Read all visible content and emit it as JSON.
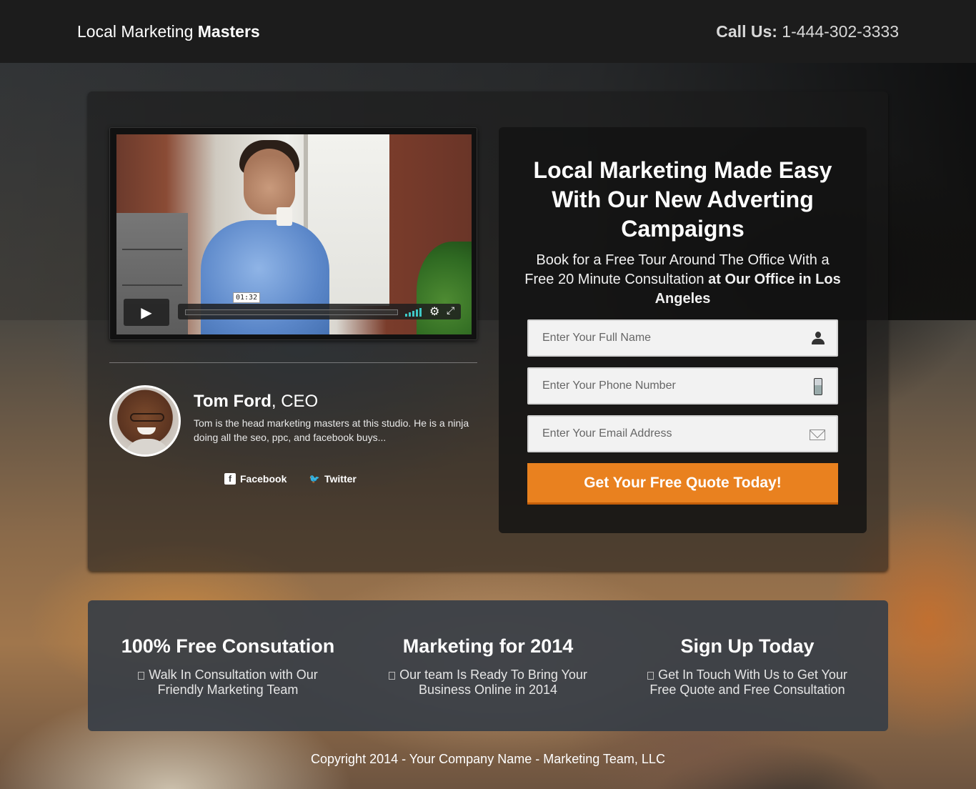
{
  "header": {
    "brand_light": "Local Marketing ",
    "brand_bold": "Masters",
    "call_label": "Call Us:",
    "call_number": " 1-444-302-3333"
  },
  "video": {
    "time": "01:32",
    "play_icon": "play-icon",
    "settings_icon": "gear-icon",
    "fullscreen_icon": "fullscreen-icon",
    "volume_icon": "volume-bars-icon",
    "volume_color": "#3ec7c5"
  },
  "profile": {
    "name": "Tom Ford",
    "role": ", CEO",
    "bio": "Tom is the head marketing masters at this studio. He is a ninja doing all the seo, ppc, and facebook buys...",
    "facebook_label": "Facebook",
    "twitter_label": "Twitter"
  },
  "form": {
    "title": "Local Marketing Made Easy With Our New Adverting Campaigns",
    "subtitle_plain": "Book for a Free Tour Around The Office With a Free 20 Minute Consultation ",
    "subtitle_bold": "at Our Office in Los Angeles",
    "name_placeholder": "Enter Your Full Name",
    "phone_placeholder": "Enter Your Phone Number",
    "email_placeholder": "Enter Your Email Address",
    "submit_label": "Get Your Free Quote Today!",
    "accent_color": "#e9811f"
  },
  "features": [
    {
      "title": "100% Free Consutation",
      "text": "Walk In Consultation with Our Friendly Marketing Team"
    },
    {
      "title": "Marketing for 2014",
      "text": "Our team Is Ready To Bring Your Business Online in 2014"
    },
    {
      "title": "Sign Up Today",
      "text": "Get In Touch With Us to Get Your Free Quote and Free Consultation"
    }
  ],
  "footer": {
    "copyright": "Copyright 2014 - Your Company Name - Marketing Team, LLC"
  }
}
